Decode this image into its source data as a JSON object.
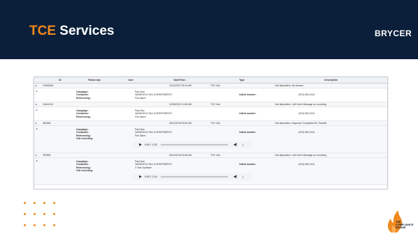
{
  "slide": {
    "title_accent": "TCE",
    "title_rest": " Services",
    "brand": "BRYCER",
    "logo_lines": [
      "THE",
      "COMPLIANCE",
      "ENGINE"
    ]
  },
  "table": {
    "columns": [
      "ID",
      "Follow Ups",
      "User",
      "Date/Time ↓",
      "Type",
      "Description"
    ],
    "records": [
      {
        "id": "23900508",
        "datetime": "11/01/2022 09:43 AM",
        "type": "TCE Call",
        "description": "Call disposition: No Answer",
        "labels": "Campaign:\nContacted:\nReferencing:",
        "values": "Past Due\nVANDIVELD HILLS APARTMENTS\nFire Alarm",
        "called_label": "Called number:",
        "phone": "(919) 594-4116",
        "recording": null
      },
      {
        "id": "13612042",
        "datetime": "10/28/2022 10:55 AM",
        "type": "TCE Call",
        "description": "Call disposition: Left Voice Message on recording",
        "labels": "Campaign:\nContacted:\nReferencing:",
        "values": "Past Due\nVANDIVELD HILLS APARTMENTS\nFire Alarm",
        "called_label": "Called number:",
        "phone": "(919) 594-4116",
        "recording": null
      },
      {
        "id": "481368",
        "datetime": "09/21/2018 09:54 AM",
        "type": "TCE Call",
        "description": "Call disposition: Inspector Completed No Transfer",
        "labels": "Campaign:\nContacted:\nReferencing:\nCall recording:",
        "values": "Past Due\nVANDIVELD HILLS APARTMENTS\nFire Alarm",
        "called_label": "Called number:",
        "phone": "(919) 594-4116",
        "recording": {
          "time": "0:00 / 1:02",
          "progress": 0.0
        }
      },
      {
        "id": "397896",
        "datetime": "09/10/2018 09:45 AM",
        "type": "TCE Call",
        "description": "Call disposition: Left Voice Message on recording",
        "labels": "Campaign:\nContacted:\nReferencing:\nCall recording:",
        "values": "Past Due\nVANDIVELD HILLS APARTMENTS\n3 Year Sprinkler",
        "called_label": "Called number:",
        "phone": "(919) 594-4116",
        "recording": {
          "time": "0:00 / 2:10",
          "progress": 0.0
        }
      }
    ]
  },
  "icons": {
    "expand": "▸",
    "play": "▶",
    "volume": "🔊",
    "menu": "⋮"
  },
  "colors": {
    "header_bg": "#0b1f3a",
    "accent": "#f0891e"
  }
}
